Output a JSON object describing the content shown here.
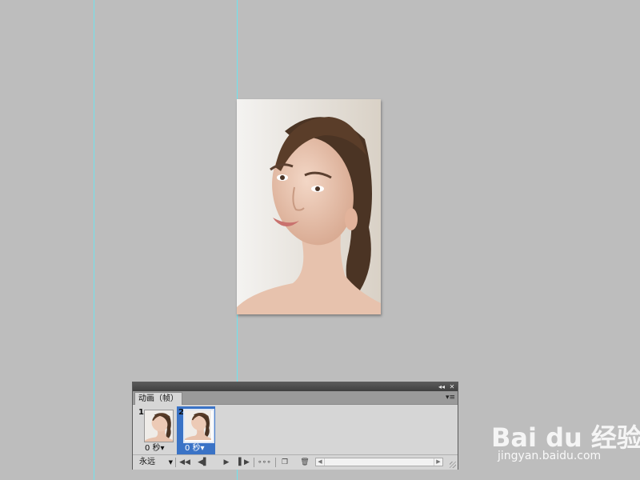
{
  "animation_panel": {
    "tab_label": "动画（帧）",
    "collapse_icon": "double-chevron-left-icon",
    "close_icon": "close-icon",
    "menu_icon": "panel-menu-icon",
    "frames": [
      {
        "number": "1",
        "delay": "0 秒▾",
        "selected": false
      },
      {
        "number": "2",
        "delay": "0 秒▾",
        "selected": true
      }
    ],
    "loop_option": "永远",
    "controls": {
      "first_frame_icon": "first-frame-icon",
      "prev_frame_icon": "previous-frame-icon",
      "play_icon": "play-icon",
      "next_frame_icon": "next-frame-icon",
      "tween_icon": "tween-icon",
      "new_frame_icon": "new-frame-icon",
      "delete_frame_icon": "trash-icon"
    },
    "selected_color": "#3a73c6"
  },
  "guides_color": "#6fe3ee",
  "canvas_background": "#bdbdbd",
  "watermark": {
    "logo_text": "Bai du 经验",
    "url": "jingyan.baidu.com"
  }
}
